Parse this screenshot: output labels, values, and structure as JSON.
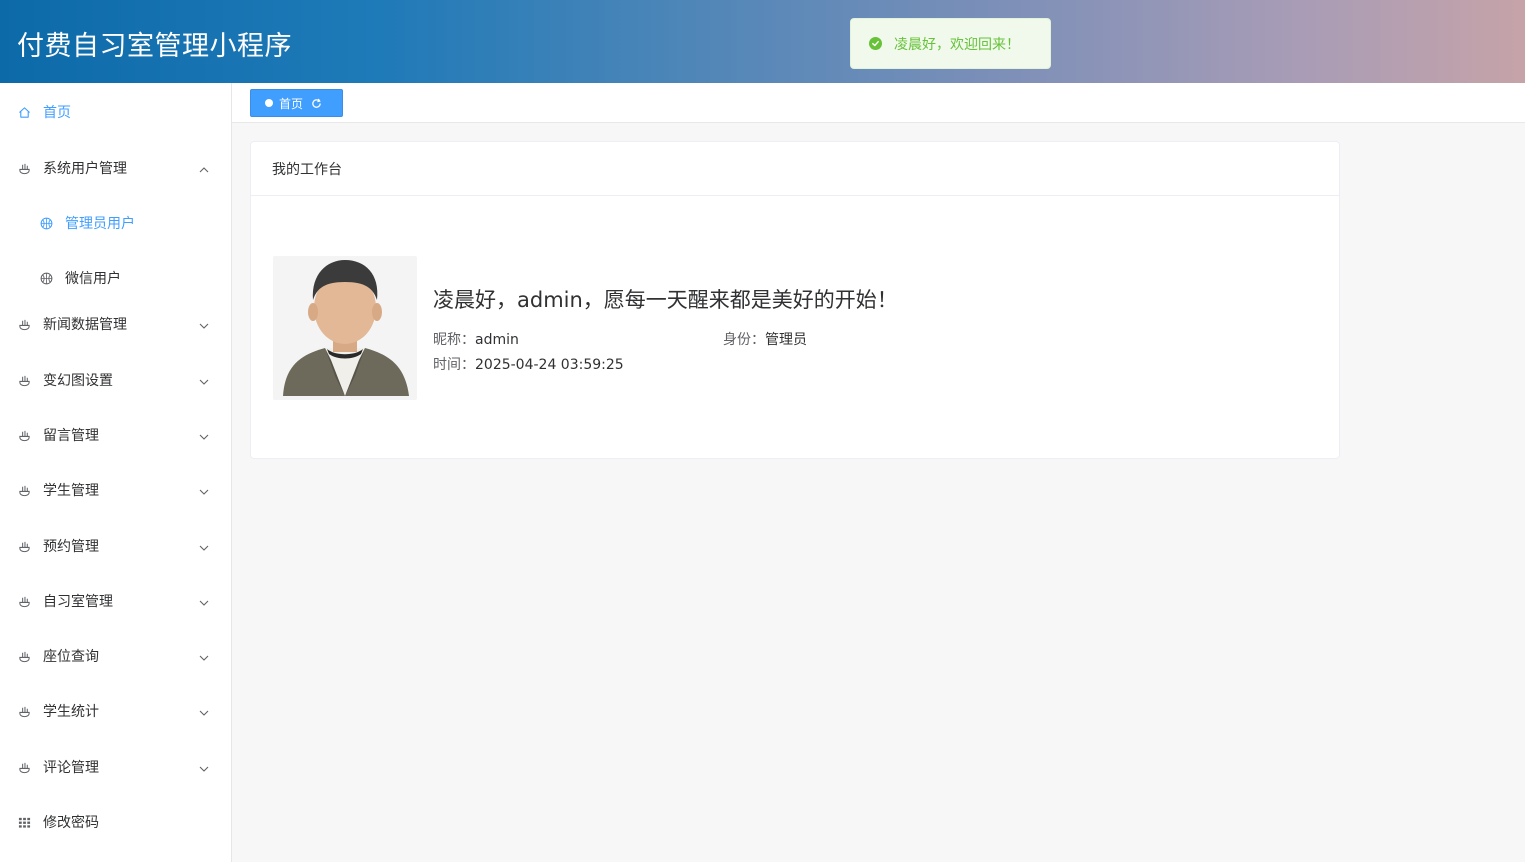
{
  "header": {
    "title": "付费自习室管理小程序"
  },
  "toast": {
    "message": "凌晨好，欢迎回来！",
    "status_color": "#67c23a"
  },
  "sidebar": {
    "items": [
      {
        "label": "首页",
        "icon": "home-icon",
        "active": true
      },
      {
        "label": "系统用户管理",
        "icon": "menu-icon",
        "expanded": true
      },
      {
        "label": "管理员用户",
        "icon": "basketball-icon",
        "active": true
      },
      {
        "label": "微信用户",
        "icon": "basketball-icon"
      },
      {
        "label": "新闻数据管理",
        "icon": "menu-icon"
      },
      {
        "label": "变幻图设置",
        "icon": "menu-icon"
      },
      {
        "label": "留言管理",
        "icon": "menu-icon"
      },
      {
        "label": "学生管理",
        "icon": "menu-icon"
      },
      {
        "label": "预约管理",
        "icon": "menu-icon"
      },
      {
        "label": "自习室管理",
        "icon": "menu-icon"
      },
      {
        "label": "座位查询",
        "icon": "menu-icon"
      },
      {
        "label": "学生统计",
        "icon": "menu-icon"
      },
      {
        "label": "评论管理",
        "icon": "menu-icon"
      },
      {
        "label": "修改密码",
        "icon": "grid-icon"
      }
    ]
  },
  "tags": {
    "home_label": "首页"
  },
  "workbench": {
    "title": "我的工作台",
    "greeting": "凌晨好，admin，愿每一天醒来都是美好的开始！",
    "nickname_label": "昵称：",
    "nickname": "admin",
    "role_label": "身份：",
    "role": "管理员",
    "time_label": "时间：",
    "time": "2025-04-24 03:59:25"
  },
  "colors": {
    "accent": "#409eff",
    "header_start": "#0d6aa8",
    "header_end": "#c6a3a8"
  }
}
